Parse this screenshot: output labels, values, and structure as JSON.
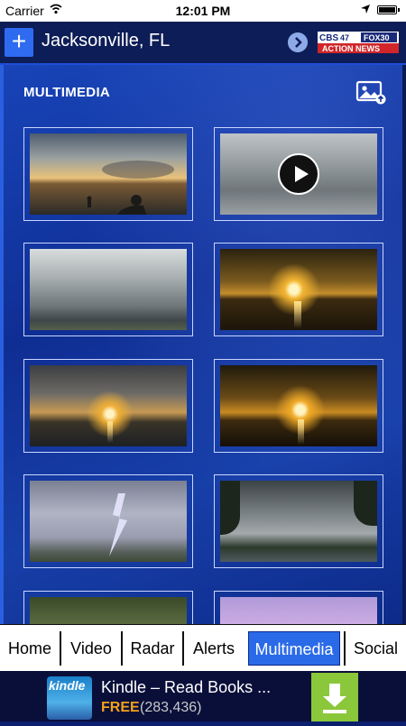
{
  "status_bar": {
    "carrier": "Carrier",
    "time": "12:01 PM",
    "battery_level": 1.0
  },
  "header": {
    "add_icon": "plus-icon",
    "location": "Jacksonville, FL",
    "nav_icon": "chevron-right-icon",
    "logo": {
      "line1_a": "CBS",
      "line1_b": "47",
      "line1_c": "FOX30",
      "line2": "ACTION NEWS"
    }
  },
  "section": {
    "title": "MULTIMEDIA",
    "upload_icon": "image-upload-icon"
  },
  "media_items": [
    {
      "name": "surfer-sunset-photo",
      "type": "photo"
    },
    {
      "name": "storm-clouds-video",
      "type": "video",
      "icon": "play-icon"
    },
    {
      "name": "shelf-cloud-photo",
      "type": "photo"
    },
    {
      "name": "lake-sunset-photo",
      "type": "photo"
    },
    {
      "name": "cloudy-sunset-photo",
      "type": "photo"
    },
    {
      "name": "golden-sunset-photo",
      "type": "photo"
    },
    {
      "name": "lightning-photo",
      "type": "photo"
    },
    {
      "name": "dark-storm-photo",
      "type": "photo"
    },
    {
      "name": "trees-photo",
      "type": "photo"
    },
    {
      "name": "purple-sky-photo",
      "type": "photo"
    }
  ],
  "tabs": [
    {
      "label": "Home",
      "active": false
    },
    {
      "label": "Video",
      "active": false
    },
    {
      "label": "Radar",
      "active": false
    },
    {
      "label": "Alerts",
      "active": false
    },
    {
      "label": "Multimedia",
      "active": true
    },
    {
      "label": "Social",
      "active": false
    }
  ],
  "ad": {
    "icon_text": "kindle",
    "title": "Kindle – Read Books ...",
    "price": "FREE",
    "rating_count": "(283,436)",
    "download_icon": "download-icon"
  },
  "colors": {
    "accent": "#2a6ae8",
    "header_bg": "#0d1d57",
    "ad_price": "#f2a21b",
    "download_bg": "#8bc73a"
  }
}
